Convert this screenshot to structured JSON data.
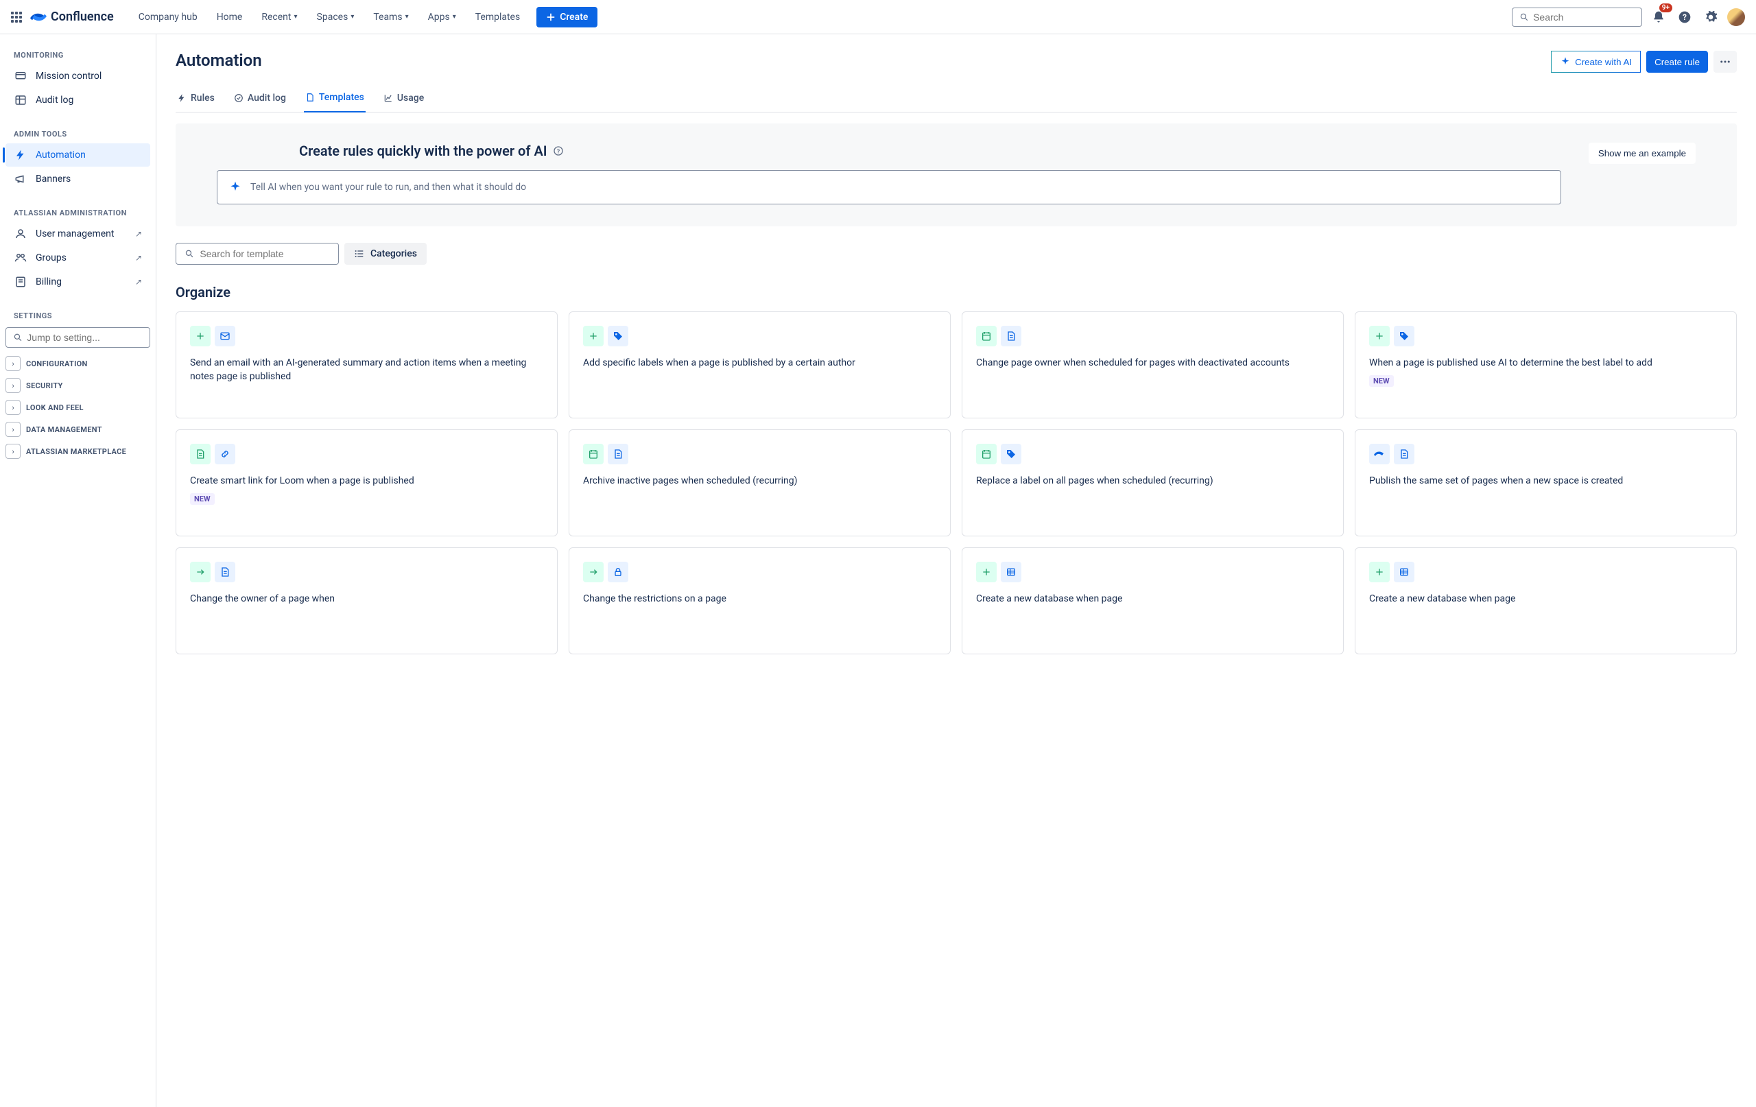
{
  "topNav": {
    "logoText": "Confluence",
    "links": [
      {
        "label": "Company hub",
        "dropdown": false
      },
      {
        "label": "Home",
        "dropdown": false
      },
      {
        "label": "Recent",
        "dropdown": true
      },
      {
        "label": "Spaces",
        "dropdown": true
      },
      {
        "label": "Teams",
        "dropdown": true
      },
      {
        "label": "Apps",
        "dropdown": true
      },
      {
        "label": "Templates",
        "dropdown": false
      }
    ],
    "createLabel": "Create",
    "searchPlaceholder": "Search",
    "notifBadge": "9+"
  },
  "sidebar": {
    "sections": [
      {
        "title": "MONITORING",
        "items": [
          {
            "label": "Mission control",
            "icon": "mission"
          },
          {
            "label": "Audit log",
            "icon": "table"
          }
        ]
      },
      {
        "title": "ADMIN TOOLS",
        "items": [
          {
            "label": "Automation",
            "icon": "bolt",
            "active": true
          },
          {
            "label": "Banners",
            "icon": "megaphone"
          }
        ]
      },
      {
        "title": "ATLASSIAN ADMINISTRATION",
        "items": [
          {
            "label": "User management",
            "icon": "user",
            "ext": true
          },
          {
            "label": "Groups",
            "icon": "group",
            "ext": true
          },
          {
            "label": "Billing",
            "icon": "billing",
            "ext": true
          }
        ]
      }
    ],
    "settingsTitle": "SETTINGS",
    "jumpPlaceholder": "Jump to setting...",
    "settingsGroups": [
      "CONFIGURATION",
      "SECURITY",
      "LOOK AND FEEL",
      "DATA MANAGEMENT",
      "ATLASSIAN MARKETPLACE"
    ]
  },
  "main": {
    "title": "Automation",
    "createAI": "Create with AI",
    "createRule": "Create rule",
    "tabs": [
      {
        "label": "Rules",
        "icon": "bolt"
      },
      {
        "label": "Audit log",
        "icon": "check-circle"
      },
      {
        "label": "Templates",
        "icon": "page",
        "active": true
      },
      {
        "label": "Usage",
        "icon": "chart"
      }
    ],
    "aiBanner": {
      "title": "Create rules quickly with the power of AI",
      "placeholder": "Tell AI when you want your rule to run, and then what it should do",
      "exampleBtn": "Show me an example"
    },
    "templateSearchPlaceholder": "Search for template",
    "categoriesLabel": "Categories",
    "sectionTitle": "Organize",
    "newPill": "NEW",
    "cards": [
      {
        "icons": [
          "plus-green",
          "mail-blue"
        ],
        "title": "Send an email with an AI-generated summary and action items when a meeting notes page is published"
      },
      {
        "icons": [
          "plus-green",
          "tag-blue"
        ],
        "title": "Add specific labels when a page is published by a certain author"
      },
      {
        "icons": [
          "calendar-green",
          "page-blue"
        ],
        "title": "Change page owner when scheduled for pages with deactivated accounts"
      },
      {
        "icons": [
          "plus-green",
          "tag-blue"
        ],
        "title": "When a page is published use AI to determine the best label to add",
        "new": true
      },
      {
        "icons": [
          "page-green",
          "link-blue"
        ],
        "title": "Create smart link for Loom when a page is published",
        "new": true
      },
      {
        "icons": [
          "calendar-green",
          "page-blue"
        ],
        "title": "Archive inactive pages when scheduled (recurring)"
      },
      {
        "icons": [
          "calendar-green",
          "tag-blue"
        ],
        "title": "Replace a label on all pages when scheduled (recurring)"
      },
      {
        "icons": [
          "conf-blue",
          "page-blue"
        ],
        "title": "Publish the same set of pages when a new space is created"
      },
      {
        "icons": [
          "arrow-green",
          "page-blue"
        ],
        "title": "Change the owner of a page when"
      },
      {
        "icons": [
          "arrow-green",
          "lock-blue"
        ],
        "title": "Change the restrictions on a page"
      },
      {
        "icons": [
          "plus-green",
          "db-blue"
        ],
        "title": "Create a new database when page"
      },
      {
        "icons": [
          "plus-green",
          "db-blue"
        ],
        "title": "Create a new database when page"
      }
    ]
  }
}
